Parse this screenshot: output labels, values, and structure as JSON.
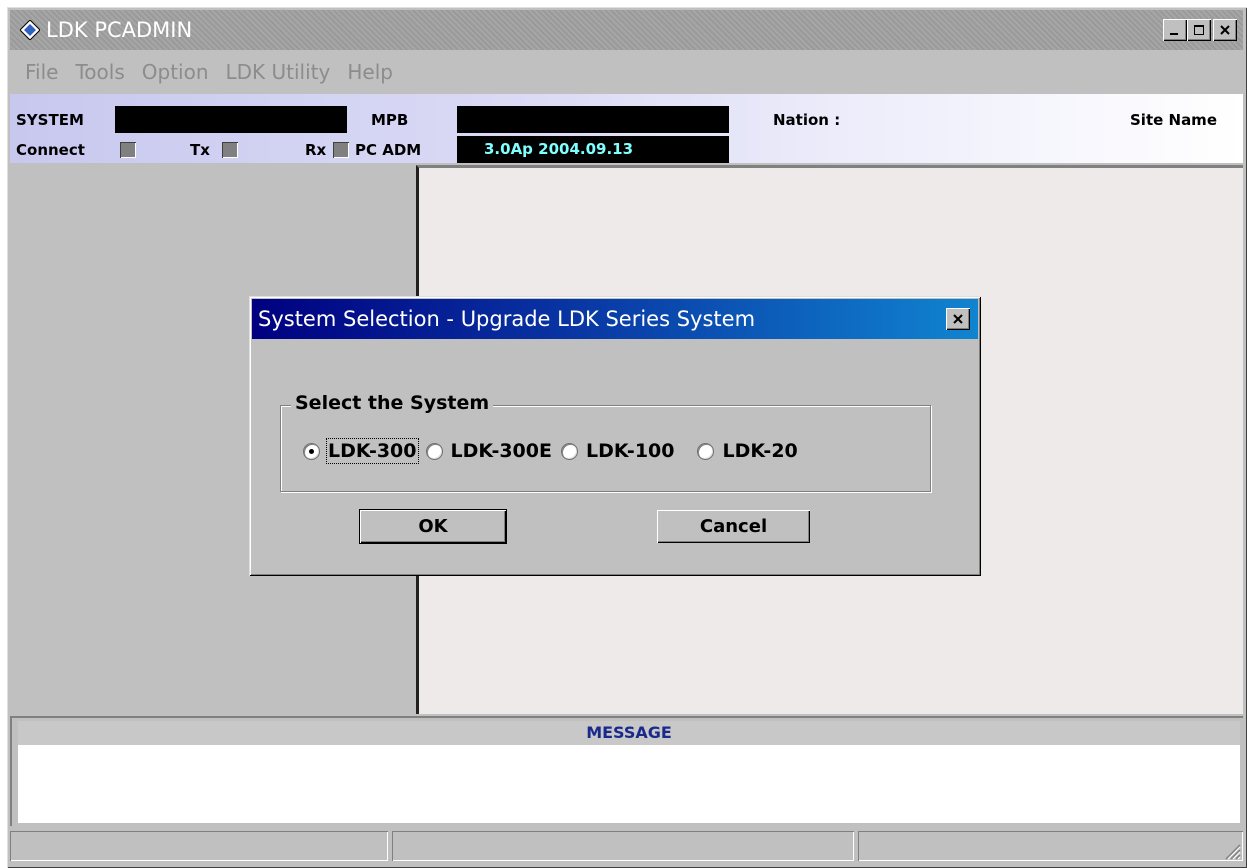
{
  "window": {
    "title": "LDK PCADMIN",
    "controls": [
      "minimize",
      "maximize",
      "close"
    ]
  },
  "menubar": {
    "items": [
      "File",
      "Tools",
      "Option",
      "LDK Utility",
      "Help"
    ]
  },
  "info": {
    "system_label": "SYSTEM",
    "system_value": "",
    "mpb_label": "MPB",
    "mpb_value": "",
    "nation_label": "Nation :",
    "site_name_label": "Site Name",
    "connect_label": "Connect",
    "tx_label": "Tx",
    "rx_label": "Rx",
    "pcadm_label": "PC ADM",
    "pcadm_value": "3.0Ap 2004.09.13"
  },
  "message": {
    "header": "MESSAGE",
    "body": ""
  },
  "dialog": {
    "title": "System Selection - Upgrade LDK Series System",
    "group_label": "Select the System",
    "options": [
      "LDK-300",
      "LDK-300E",
      "LDK-100",
      "LDK-20"
    ],
    "selected": "LDK-300",
    "ok_label": "OK",
    "cancel_label": "Cancel"
  },
  "colors": {
    "title_inactive": "#a0a0a0",
    "dialog_title": "#000080",
    "version_text": "#7fffff",
    "message_header_text": "#1a2a8a"
  }
}
